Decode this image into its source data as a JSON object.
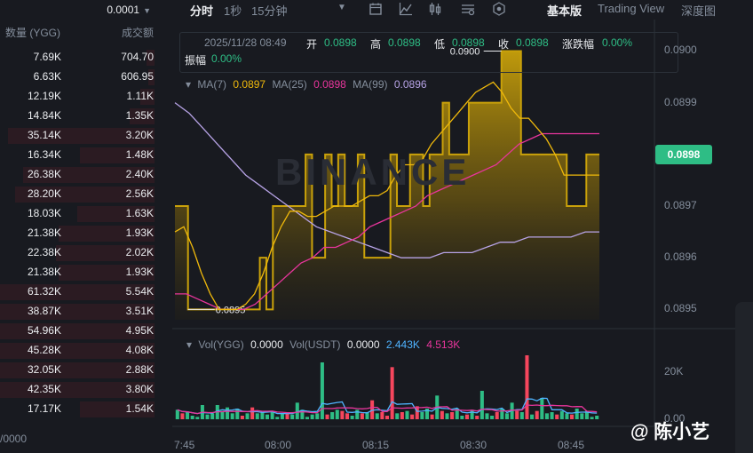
{
  "orderbook": {
    "precision": "0.0001",
    "col_qty": "数量 (YGG)",
    "col_turnover": "成交额",
    "rows": [
      {
        "qty": "7.69K",
        "turnover": "704.70",
        "depth": 0.05
      },
      {
        "qty": "6.63K",
        "turnover": "606.95",
        "depth": 0.04
      },
      {
        "qty": "12.19K",
        "turnover": "1.11K",
        "depth": 0.09
      },
      {
        "qty": "14.84K",
        "turnover": "1.35K",
        "depth": 0.16
      },
      {
        "qty": "35.14K",
        "turnover": "3.20K",
        "depth": 0.95
      },
      {
        "qty": "16.34K",
        "turnover": "1.48K",
        "depth": 0.48
      },
      {
        "qty": "26.38K",
        "turnover": "2.40K",
        "depth": 0.85
      },
      {
        "qty": "28.20K",
        "turnover": "2.56K",
        "depth": 0.9
      },
      {
        "qty": "18.03K",
        "turnover": "1.63K",
        "depth": 0.5
      },
      {
        "qty": "21.38K",
        "turnover": "1.93K",
        "depth": 0.62
      },
      {
        "qty": "22.38K",
        "turnover": "2.02K",
        "depth": 0.64
      },
      {
        "qty": "21.38K",
        "turnover": "1.93K",
        "depth": 0.62
      },
      {
        "qty": "61.32K",
        "turnover": "5.54K",
        "depth": 1.0
      },
      {
        "qty": "38.87K",
        "turnover": "3.51K",
        "depth": 1.0
      },
      {
        "qty": "54.96K",
        "turnover": "4.95K",
        "depth": 1.0
      },
      {
        "qty": "45.28K",
        "turnover": "4.08K",
        "depth": 1.0
      },
      {
        "qty": "32.05K",
        "turnover": "2.88K",
        "depth": 1.0
      },
      {
        "qty": "42.35K",
        "turnover": "3.80K",
        "depth": 1.0
      },
      {
        "qty": "17.17K",
        "turnover": "1.54K",
        "depth": 0.48
      }
    ],
    "footer": "/0000"
  },
  "toolbar": {
    "tab_time": "分时",
    "tab_1s": "1秒",
    "tab_15m": "15分钟",
    "view_basic": "基本版",
    "view_tradingview": "Trading View",
    "view_depth": "深度图",
    "icons": [
      "chevron-down-icon",
      "calendar-icon",
      "indicator-icon",
      "candle-settings-icon",
      "chart-settings-icon",
      "hexagon-icon"
    ]
  },
  "ohlc": {
    "date": "2025/11/28 08:49",
    "open_label": "开",
    "open": "0.0898",
    "high_label": "高",
    "high": "0.0898",
    "low_label": "低",
    "low": "0.0898",
    "close_label": "收",
    "close": "0.0898",
    "change_label": "涨跌幅",
    "change": "0.00%",
    "amp_label": "振幅",
    "amp": "0.00%"
  },
  "ma": {
    "ma7_label": "MA(7)",
    "ma7": "0.0897",
    "ma25_label": "MA(25)",
    "ma25": "0.0898",
    "ma99_label": "MA(99)",
    "ma99": "0.0896"
  },
  "vol": {
    "ygg_label": "Vol(YGG)",
    "ygg": "0.0000",
    "usdt_label": "Vol(USDT)",
    "usdt": "0.0000",
    "v1": "2.443K",
    "v2": "4.513K"
  },
  "chart_data": {
    "type": "area",
    "price_axis": [
      "0.0900",
      "0.0899",
      "0.0898",
      "0.0897",
      "0.0896",
      "0.0895"
    ],
    "current_price": "0.0898",
    "high_marker": "0.0900",
    "low_marker": "0.0895",
    "ylim": [
      0.08948,
      0.09003
    ],
    "price": [
      0.0897,
      0.0897,
      0.0895,
      0.0895,
      0.0895,
      0.0895,
      0.0895,
      0.0895,
      0.0895,
      0.0895,
      0.0895,
      0.0895,
      0.0895,
      0.0896,
      0.0895,
      0.0897,
      0.0897,
      0.0897,
      0.0897,
      0.0897,
      0.0898,
      0.0896,
      0.0896,
      0.0898,
      0.0897,
      0.0898,
      0.0897,
      0.0897,
      0.0898,
      0.0896,
      0.0896,
      0.0896,
      0.0896,
      0.0898,
      0.0897,
      0.0897,
      0.0898,
      0.0898,
      0.0897,
      0.0898,
      0.0898,
      0.0899,
      0.0898,
      0.0898,
      0.0898,
      0.0899,
      0.0899,
      0.0899,
      0.0899,
      0.0899,
      0.09,
      0.09,
      0.09,
      0.0898,
      0.0898,
      0.0898,
      0.0898,
      0.0898,
      0.0898,
      0.0898,
      0.0897,
      0.0897,
      0.0897,
      0.0898,
      0.0898,
      0.0898
    ],
    "ma7": [
      0.08965,
      0.08966,
      0.08962,
      0.08957,
      0.08953,
      0.0895,
      0.0895,
      0.0895,
      0.08951,
      0.08953,
      0.08957,
      0.08962,
      0.08966,
      0.08969,
      0.08969,
      0.08968,
      0.08968,
      0.08969,
      0.0897,
      0.0897,
      0.0897,
      0.08971,
      0.08972,
      0.08972,
      0.08973,
      0.08976,
      0.08978,
      0.08978,
      0.08979,
      0.08982,
      0.08984,
      0.08986,
      0.08988,
      0.0899,
      0.08992,
      0.08993,
      0.08994,
      0.08992,
      0.08989,
      0.08987,
      0.08987,
      0.08985,
      0.08983,
      0.0898,
      0.08976,
      0.08976,
      0.08976,
      0.08976,
      0.08976
    ],
    "ma25": [
      0.08953,
      0.08953,
      0.08952,
      0.08951,
      0.0895,
      0.0895,
      0.0895,
      0.08951,
      0.08953,
      0.08955,
      0.08957,
      0.08959,
      0.0896,
      0.08962,
      0.08962,
      0.08963,
      0.08964,
      0.08966,
      0.08967,
      0.08968,
      0.08969,
      0.0897,
      0.08972,
      0.08973,
      0.08974,
      0.08975,
      0.08976,
      0.08977,
      0.08978,
      0.0898,
      0.08982,
      0.08983,
      0.08984,
      0.08984,
      0.08984,
      0.08984,
      0.08984,
      0.08984
    ],
    "ma99": [
      0.0899,
      0.08988,
      0.08985,
      0.08982,
      0.08979,
      0.08976,
      0.08974,
      0.08972,
      0.0897,
      0.08968,
      0.08966,
      0.08965,
      0.08964,
      0.08963,
      0.08962,
      0.08961,
      0.0896,
      0.0896,
      0.0896,
      0.08961,
      0.08961,
      0.08961,
      0.08962,
      0.08963,
      0.08963,
      0.08964,
      0.08964,
      0.08964,
      0.08964,
      0.08965,
      0.08965
    ],
    "vol_axis": [
      "20K",
      "0.00"
    ],
    "vol_ylim": [
      0,
      27000
    ],
    "volume": [
      4000,
      2500,
      3000,
      1500,
      1000,
      6000,
      2000,
      2500,
      6000,
      3500,
      5000,
      2500,
      4500,
      1500,
      2500,
      5000,
      2500,
      3000,
      2000,
      3500,
      1000,
      2500,
      3000,
      2000,
      7000,
      4000,
      1000,
      2000,
      2500,
      24000,
      2000,
      3000,
      4000,
      3500,
      2500,
      1500,
      4000,
      2500,
      3000,
      8000,
      2500,
      3000,
      1500,
      22000,
      2500,
      3000,
      3500,
      2000,
      5500,
      3000,
      4500,
      2000,
      10000,
      3500,
      2500,
      3000,
      4500,
      1500,
      2000,
      4000,
      1500,
      12000,
      2500,
      1500,
      3000,
      4500,
      2500,
      7000,
      3500,
      3000,
      27000,
      2000,
      3500,
      9000,
      2500,
      3000,
      2000,
      3500,
      2500,
      2000,
      4500,
      2500,
      3500,
      1000,
      1500
    ],
    "vol_up": [
      true,
      false,
      true,
      true,
      true,
      true,
      true,
      true,
      true,
      true,
      true,
      true,
      true,
      false,
      true,
      false,
      true,
      true,
      true,
      true,
      true,
      true,
      false,
      true,
      true,
      true,
      true,
      true,
      true,
      true,
      false,
      true,
      true,
      false,
      false,
      true,
      true,
      false,
      true,
      false,
      true,
      false,
      false,
      false,
      true,
      false,
      true,
      false,
      false,
      true,
      true,
      false,
      true,
      false,
      true,
      false,
      true,
      true,
      false,
      true,
      false,
      true,
      true,
      true,
      false,
      true,
      true,
      true,
      false,
      true,
      false,
      true,
      false,
      true,
      true,
      true,
      false,
      true,
      true,
      false,
      true,
      true,
      true,
      true,
      true
    ],
    "x_ticks": [
      "7:45",
      "08:00",
      "08:15",
      "08:30",
      "08:45"
    ]
  },
  "watermark": {
    "text": "@ 陈小艺",
    "logo": "BINANCE"
  },
  "colors": {
    "up": "#2ebd85",
    "down": "#f6465d",
    "area": "#c9a10a",
    "ma7": "#f0b90b",
    "ma25": "#e8359c",
    "ma99": "#b7a3e6",
    "vol_ma1": "#4fb3ff",
    "vol_ma2": "#e8359c"
  }
}
